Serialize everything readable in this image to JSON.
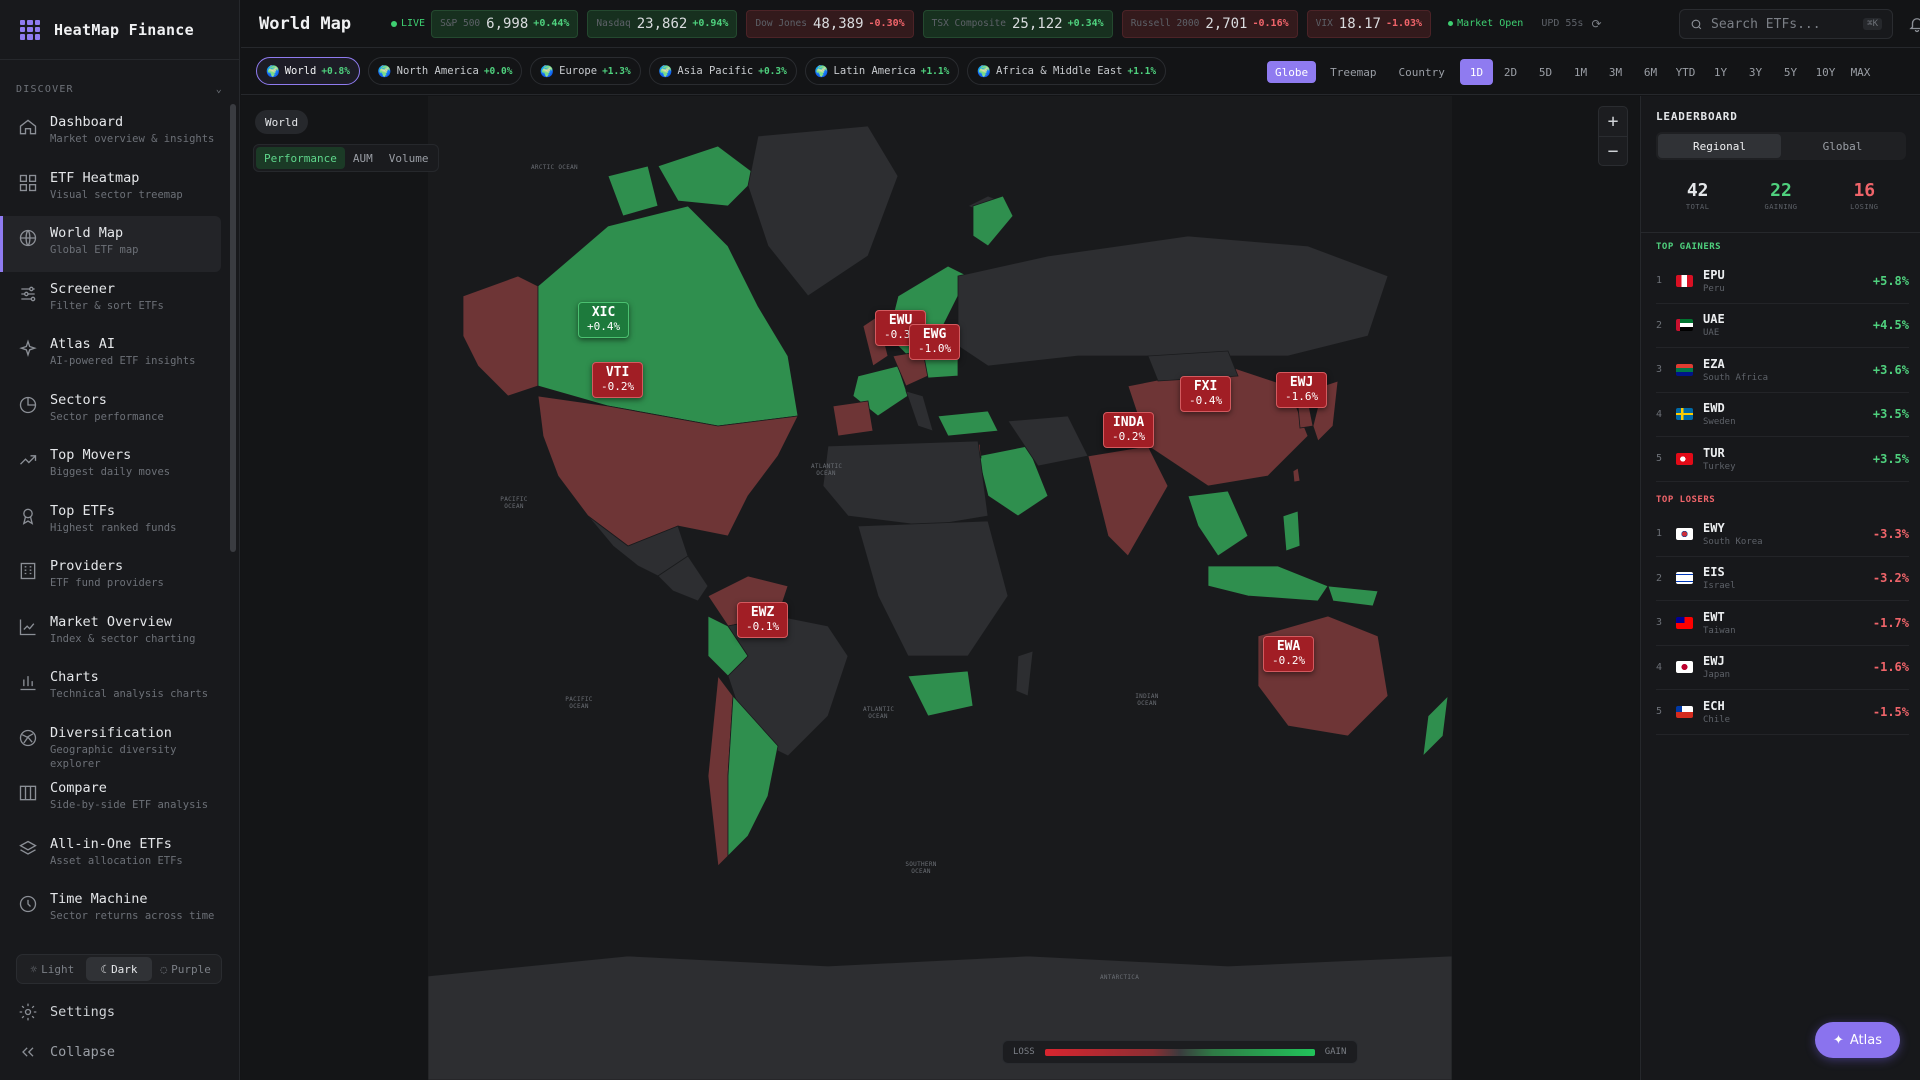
{
  "app": {
    "name": "HeatMap Finance"
  },
  "sidebar": {
    "section_label": "DISCOVER",
    "items": [
      {
        "label": "Dashboard",
        "sub": "Market overview & insights",
        "icon": "home-icon"
      },
      {
        "label": "ETF Heatmap",
        "sub": "Visual sector treemap",
        "icon": "grid-icon"
      },
      {
        "label": "World Map",
        "sub": "Global ETF map",
        "icon": "globe-icon"
      },
      {
        "label": "Screener",
        "sub": "Filter & sort ETFs",
        "icon": "sliders-icon"
      },
      {
        "label": "Atlas AI",
        "sub": "AI-powered ETF insights",
        "icon": "sparkle-icon"
      },
      {
        "label": "Sectors",
        "sub": "Sector performance",
        "icon": "pie-icon"
      },
      {
        "label": "Top Movers",
        "sub": "Biggest daily moves",
        "icon": "trend-icon"
      },
      {
        "label": "Top ETFs",
        "sub": "Highest ranked funds",
        "icon": "award-icon"
      },
      {
        "label": "Providers",
        "sub": "ETF fund providers",
        "icon": "building-icon"
      },
      {
        "label": "Market Overview",
        "sub": "Index & sector charting",
        "icon": "linechart-icon"
      },
      {
        "label": "Charts",
        "sub": "Technical analysis charts",
        "icon": "barchart-icon"
      },
      {
        "label": "Diversification",
        "sub": "Geographic diversity explorer",
        "icon": "globe-network-icon"
      },
      {
        "label": "Compare",
        "sub": "Side-by-side ETF analysis",
        "icon": "columns-icon"
      },
      {
        "label": "All-in-One ETFs",
        "sub": "Asset allocation ETFs",
        "icon": "layers-icon"
      },
      {
        "label": "Time Machine",
        "sub": "Sector returns across time",
        "icon": "clock-icon"
      }
    ],
    "active_index": 2,
    "theme": {
      "light": "Light",
      "dark": "Dark",
      "purple": "Purple",
      "active": "Dark"
    },
    "settings_label": "Settings",
    "collapse_label": "Collapse"
  },
  "topbar": {
    "title": "World Map",
    "live_label": "LIVE",
    "tickers": [
      {
        "name": "S&P 500",
        "value": "6,998",
        "change": "+0.44%",
        "dir": "up"
      },
      {
        "name": "Nasdaq",
        "value": "23,862",
        "change": "+0.94%",
        "dir": "up"
      },
      {
        "name": "Dow Jones",
        "value": "48,389",
        "change": "-0.30%",
        "dir": "down"
      },
      {
        "name": "TSX Composite",
        "value": "25,122",
        "change": "+0.34%",
        "dir": "up"
      },
      {
        "name": "Russell 2000",
        "value": "2,701",
        "change": "-0.16%",
        "dir": "down"
      },
      {
        "name": "VIX",
        "value": "18.17",
        "change": "-1.03%",
        "dir": "down"
      }
    ],
    "market_status": "Market Open",
    "updated": "UPD 55s",
    "search_placeholder": "Search ETFs...",
    "search_shortcut": "⌘K"
  },
  "regions": [
    {
      "label": "World",
      "change": "+0.8%"
    },
    {
      "label": "North America",
      "change": "+0.0%"
    },
    {
      "label": "Europe",
      "change": "+1.3%"
    },
    {
      "label": "Asia Pacific",
      "change": "+0.3%"
    },
    {
      "label": "Latin America",
      "change": "+1.1%"
    },
    {
      "label": "Africa & Middle East",
      "change": "+1.1%"
    }
  ],
  "views": [
    "Globe",
    "Treemap",
    "Country"
  ],
  "active_view": "Globe",
  "periods": [
    "1D",
    "2D",
    "5D",
    "1M",
    "3M",
    "6M",
    "YTD",
    "1Y",
    "3Y",
    "5Y",
    "10Y",
    "MAX"
  ],
  "active_period": "1D",
  "map": {
    "scope_tag": "World",
    "metric_tabs": [
      "Performance",
      "AUM",
      "Volume"
    ],
    "active_metric": "Performance",
    "labels": [
      {
        "ticker": "XIC",
        "change": "+0.4%",
        "dir": "up"
      },
      {
        "ticker": "VTI",
        "change": "-0.2%",
        "dir": "down"
      },
      {
        "ticker": "EWU",
        "change": "-0.3%",
        "dir": "down"
      },
      {
        "ticker": "EWG",
        "change": "-1.0%",
        "dir": "down"
      },
      {
        "ticker": "FXI",
        "change": "-0.4%",
        "dir": "down"
      },
      {
        "ticker": "EWJ",
        "change": "-1.6%",
        "dir": "down"
      },
      {
        "ticker": "INDA",
        "change": "-0.2%",
        "dir": "down"
      },
      {
        "ticker": "EWZ",
        "change": "-0.1%",
        "dir": "down"
      },
      {
        "ticker": "EWA",
        "change": "-0.2%",
        "dir": "down"
      }
    ],
    "ocean_labels": [
      "ARCTIC OCEAN",
      "ATLANTIC OCEAN",
      "PACIFIC OCEAN",
      "INDIAN OCEAN",
      "SOUTHERN OCEAN",
      "ANTARCTICA",
      "PACIFIC OCEAN",
      "ATLANTIC OCEAN"
    ],
    "legend": {
      "loss": "LOSS",
      "gain": "GAIN"
    },
    "colors": {
      "gain": "#2f8f4e",
      "loss": "#6e3536",
      "neutral": "#2d2e31"
    }
  },
  "leaderboard": {
    "title": "LEADERBOARD",
    "tabs": [
      "Regional",
      "Global"
    ],
    "active_tab": "Regional",
    "stats": {
      "total": "42",
      "total_label": "TOTAL",
      "gaining": "22",
      "gaining_label": "GAINING",
      "losing": "16",
      "losing_label": "LOSING"
    },
    "gainers_title": "TOP GAINERS",
    "gainers": [
      {
        "rank": "1",
        "ticker": "EPU",
        "country": "Peru",
        "change": "+5.8%",
        "flag": "peru-flag"
      },
      {
        "rank": "2",
        "ticker": "UAE",
        "country": "UAE",
        "change": "+4.5%",
        "flag": "uae-flag"
      },
      {
        "rank": "3",
        "ticker": "EZA",
        "country": "South Africa",
        "change": "+3.6%",
        "flag": "south-africa-flag"
      },
      {
        "rank": "4",
        "ticker": "EWD",
        "country": "Sweden",
        "change": "+3.5%",
        "flag": "sweden-flag"
      },
      {
        "rank": "5",
        "ticker": "TUR",
        "country": "Turkey",
        "change": "+3.5%",
        "flag": "turkey-flag"
      }
    ],
    "losers_title": "TOP LOSERS",
    "losers": [
      {
        "rank": "1",
        "ticker": "EWY",
        "country": "South Korea",
        "change": "-3.3%",
        "flag": "south-korea-flag"
      },
      {
        "rank": "2",
        "ticker": "EIS",
        "country": "Israel",
        "change": "-3.2%",
        "flag": "israel-flag"
      },
      {
        "rank": "3",
        "ticker": "EWT",
        "country": "Taiwan",
        "change": "-1.7%",
        "flag": "taiwan-flag"
      },
      {
        "rank": "4",
        "ticker": "EWJ",
        "country": "Japan",
        "change": "-1.6%",
        "flag": "japan-flag"
      },
      {
        "rank": "5",
        "ticker": "ECH",
        "country": "Chile",
        "change": "-1.5%",
        "flag": "chile-flag"
      }
    ]
  },
  "atlas_button": "Atlas"
}
